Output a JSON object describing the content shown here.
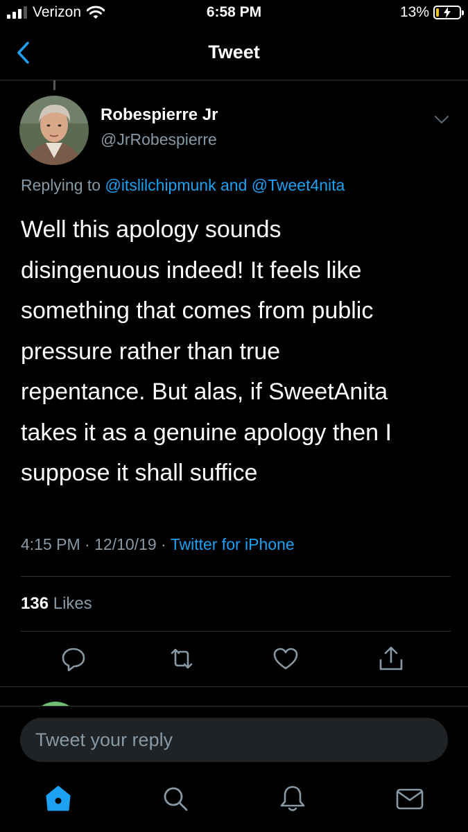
{
  "status_bar": {
    "carrier": "Verizon",
    "time": "6:58 PM",
    "battery_percent": "13%",
    "battery_level": 0.13
  },
  "nav": {
    "title": "Tweet"
  },
  "tweet": {
    "author_name": "Robespierre Jr",
    "author_handle": "@JrRobespierre",
    "replying_prefix": "Replying to",
    "replying_user1": "@itslilchipmunk",
    "replying_and": "and",
    "replying_user2": "@Tweet4nita",
    "text_lines": [
      "Well this apology sounds",
      "disingenuous indeed! It feels like",
      "something that comes from public",
      "pressure rather than true",
      "repentance. But alas, if SweetAnita",
      "takes it as a genuine apology then I",
      "suppose it shall suffice"
    ],
    "time": "4:15 PM",
    "date": "12/10/19",
    "separator": "·",
    "source": "Twitter for iPhone",
    "likes_count": "136",
    "likes_label": "Likes"
  },
  "reply_box": {
    "placeholder": "Tweet your reply"
  },
  "colors": {
    "background": "#000000",
    "accent": "#1da1f2",
    "secondary_text": "#8899a6",
    "divider": "#2f3336",
    "battery_low": "#f0c30f"
  },
  "icons": {
    "actions": [
      "reply-icon",
      "retweet-icon",
      "like-icon",
      "share-icon"
    ],
    "tabs": [
      "home-icon",
      "search-icon",
      "notifications-icon",
      "messages-icon"
    ]
  }
}
